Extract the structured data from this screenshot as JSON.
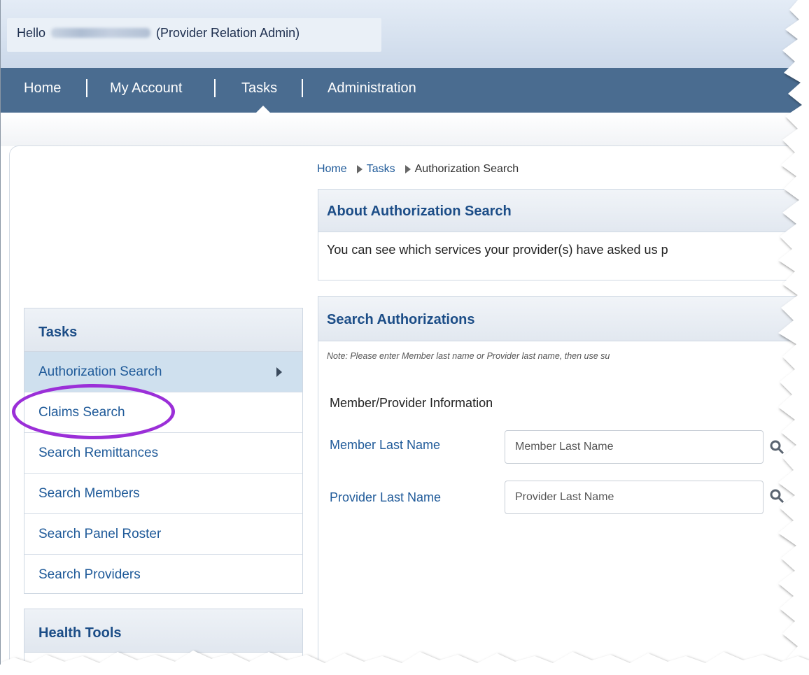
{
  "header": {
    "greeting_prefix": "Hello",
    "greeting_role": "(Provider Relation Admin)"
  },
  "nav": {
    "items": [
      "Home",
      "My Account",
      "Tasks",
      "Administration"
    ],
    "active": "Tasks"
  },
  "breadcrumb": {
    "items": [
      "Home",
      "Tasks",
      "Authorization Search"
    ]
  },
  "about": {
    "title": "About Authorization Search",
    "text": "You can see which services your provider(s) have asked us p"
  },
  "search": {
    "title": "Search Authorizations",
    "note": "Note: Please enter Member last name or Provider last name, then use su",
    "section_label": "Member/Provider Information",
    "fields": [
      {
        "label": "Member Last Name",
        "placeholder": "Member Last Name"
      },
      {
        "label": "Provider Last Name",
        "placeholder": "Provider Last Name"
      }
    ]
  },
  "sidebar": {
    "tasks_title": "Tasks",
    "items": [
      {
        "label": "Authorization Search"
      },
      {
        "label": "Claims Search"
      },
      {
        "label": "Search Remittances"
      },
      {
        "label": "Search Members"
      },
      {
        "label": "Search Panel Roster"
      },
      {
        "label": "Search Providers"
      }
    ],
    "active_item": "Authorization Search",
    "health_title": "Health Tools"
  },
  "annotation": {
    "highlight_color": "#9b2fd8"
  },
  "colors": {
    "nav_bg": "#4a6c90",
    "link": "#1f5a99",
    "heading": "#1c4d87"
  }
}
